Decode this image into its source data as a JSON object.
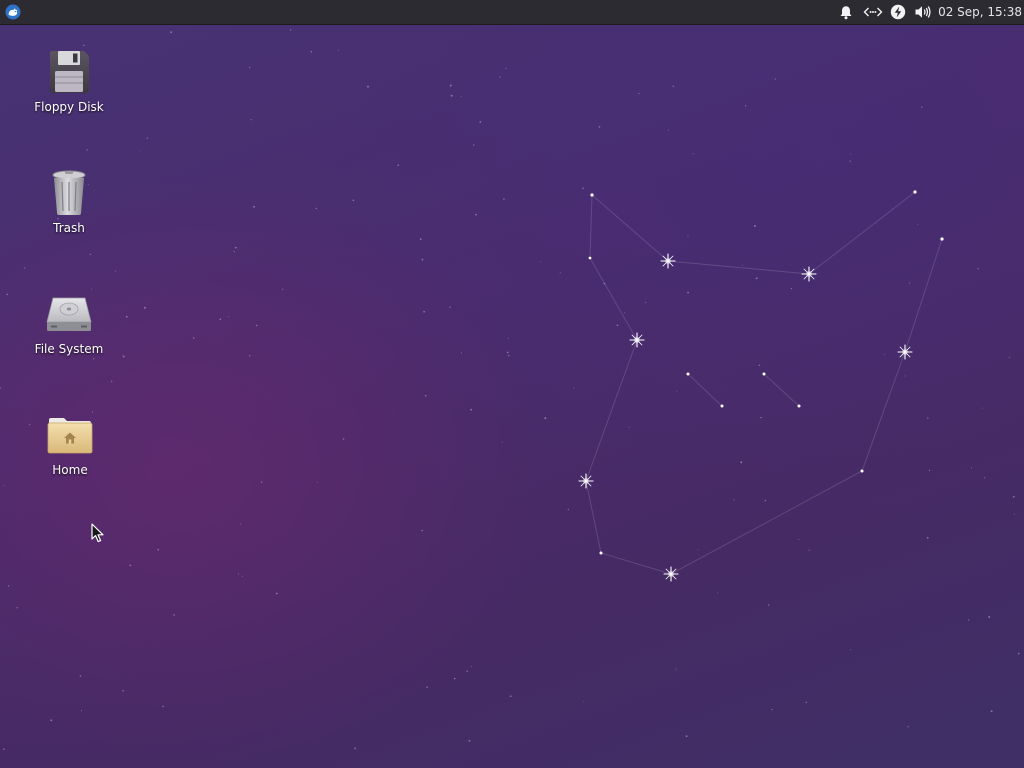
{
  "panel": {
    "menu_icon": "xfce-mouse-logo-icon",
    "tray_icons": [
      "bell-icon",
      "network-disconnected-icon",
      "power-icon",
      "volume-icon"
    ],
    "clock": "02 Sep, 15:38"
  },
  "desktop": {
    "icons": [
      {
        "label": "Floppy Disk",
        "icon": "floppy-disk-icon"
      },
      {
        "label": "Trash",
        "icon": "trash-icon"
      },
      {
        "label": "File System",
        "icon": "hard-drive-icon"
      },
      {
        "label": "Home",
        "icon": "home-folder-icon"
      }
    ]
  },
  "colors": {
    "panel_bg": "#2b2b31",
    "wallpaper": "#472e6c",
    "accent": "#2f73c8"
  }
}
